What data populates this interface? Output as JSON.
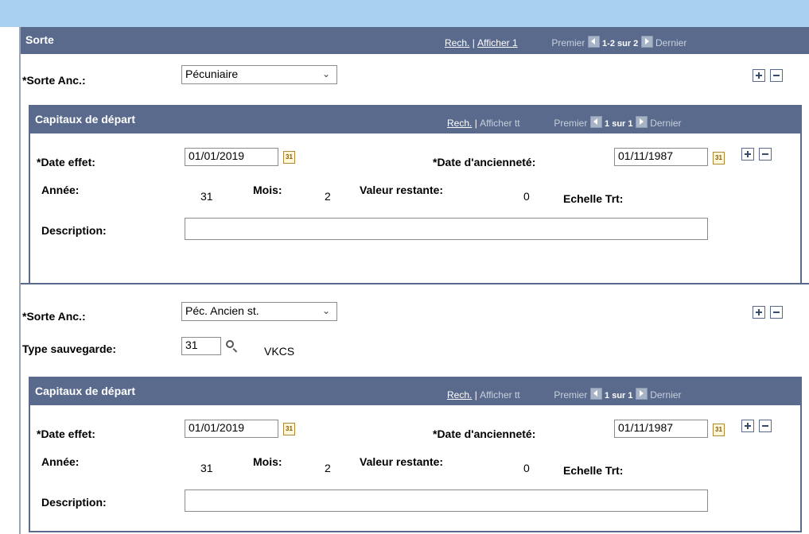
{
  "outer_header": {
    "title": "Sorte",
    "rech": "Rech.",
    "sep": "|",
    "afficher": "Afficher 1",
    "premier": "Premier",
    "count": "1-2 sur 2",
    "dernier": "Dernier"
  },
  "rows": [
    {
      "sorte_label": "*Sorte Anc.:",
      "sorte_value": "Pécuniaire",
      "cap": {
        "title": "Capitaux de départ",
        "rech": "Rech.",
        "sep": "|",
        "afficher": "Afficher tt",
        "premier": "Premier",
        "count": "1 sur 1",
        "dernier": "Dernier",
        "date_effet_label": "*Date effet:",
        "date_effet_value": "01/01/2019",
        "date_anc_label": "*Date d'ancienneté:",
        "date_anc_value": "01/11/1987",
        "annee_label": "Année:",
        "annee_value": "31",
        "mois_label": "Mois:",
        "mois_value": "2",
        "valeur_label": "Valeur restante:",
        "valeur_value": "0",
        "echelle_label": "Echelle Trt:",
        "description_label": "Description:",
        "description_value": ""
      }
    },
    {
      "sorte_label": "*Sorte Anc.:",
      "sorte_value": "Péc. Ancien st.",
      "type_label": "Type sauvegarde:",
      "type_value": "31",
      "type_desc": "VKCS",
      "cap": {
        "title": "Capitaux de départ",
        "rech": "Rech.",
        "sep": "|",
        "afficher": "Afficher tt",
        "premier": "Premier",
        "count": "1 sur 1",
        "dernier": "Dernier",
        "date_effet_label": "*Date effet:",
        "date_effet_value": "01/01/2019",
        "date_anc_label": "*Date d'ancienneté:",
        "date_anc_value": "01/11/1987",
        "annee_label": "Année:",
        "annee_value": "31",
        "mois_label": "Mois:",
        "mois_value": "2",
        "valeur_label": "Valeur restante:",
        "valeur_value": "0",
        "echelle_label": "Echelle Trt:",
        "description_label": "Description:",
        "description_value": ""
      }
    }
  ],
  "icons": {
    "calendar_glyph": "31"
  },
  "colors": {
    "header_bg": "#5a6a8c",
    "top_band": "#a9d0ee",
    "border": "#5a6a8c"
  }
}
